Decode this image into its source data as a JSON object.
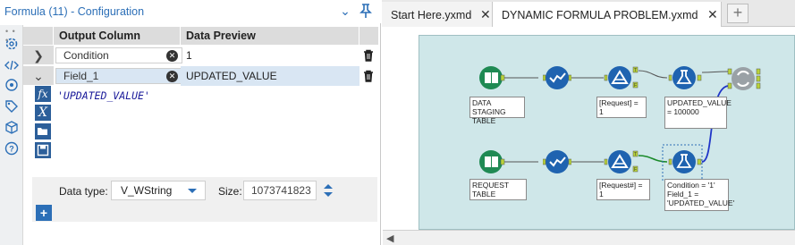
{
  "config": {
    "title": "Formula (11) - Configuration"
  },
  "grid": {
    "col_output": "Output Column",
    "col_preview": "Data Preview",
    "rows": [
      {
        "name": "Condition",
        "preview": "1"
      },
      {
        "name": "Field_1",
        "preview": "UPDATED_VALUE"
      }
    ]
  },
  "expression": "'UPDATED_VALUE'",
  "datatype": {
    "label": "Data type:",
    "value": "V_WString",
    "size_label": "Size:",
    "size_value": "1073741823"
  },
  "tabs": [
    {
      "label": "Start Here.yxmd"
    },
    {
      "label": "DYNAMIC FORMULA PROBLEM.yxmd"
    }
  ],
  "workflow": {
    "labels": {
      "staging": "DATA STAGING TABLE",
      "filter1": "[Request] = 1",
      "formula1": "UPDATED_VALUE = 100000",
      "request": "REQUEST TABLE",
      "filter2": "[Request#] = 1",
      "formula2": "Condition = '1' Field_1 = 'UPDATED_VALUE'"
    }
  },
  "colors": {
    "accent": "#2c6fb7",
    "canvas": "#cfe7e9"
  }
}
